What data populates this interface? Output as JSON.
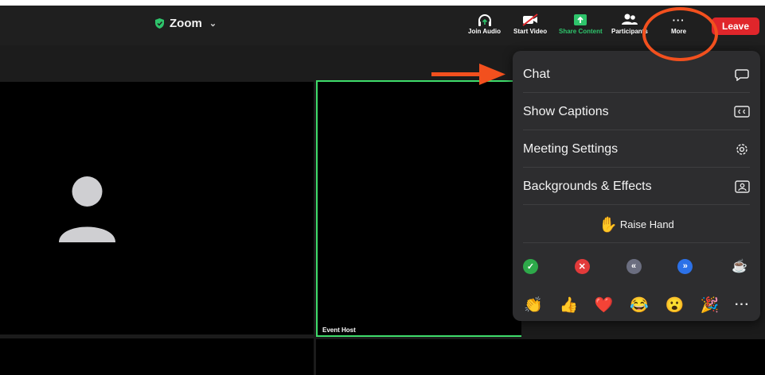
{
  "window": {
    "title": "Zoom",
    "title_chevron": "⌄"
  },
  "toolbar": {
    "join_audio": "Join Audio",
    "start_video": "Start Video",
    "share_content": "Share Content",
    "participants": "Participants",
    "more": "More",
    "more_dots": "···",
    "leave": "Leave"
  },
  "colors": {
    "accent_green": "#3fdc6b",
    "leave_red": "#e0262b",
    "annotation_orange": "#f2501e"
  },
  "tiles": {
    "host_label": "Event Host"
  },
  "menu": {
    "items": [
      {
        "label": "Chat",
        "icon": "chat-bubble-icon"
      },
      {
        "label": "Show Captions",
        "icon": "cc-icon"
      },
      {
        "label": "Meeting Settings",
        "icon": "gear-icon"
      },
      {
        "label": "Backgrounds & Effects",
        "icon": "portrait-icon"
      }
    ],
    "raise_hand": {
      "emoji": "✋",
      "label": "Raise Hand"
    },
    "feedback_row": [
      {
        "name": "yes-check",
        "glyph": "✓",
        "color": "#2ea94a"
      },
      {
        "name": "no-x",
        "glyph": "✕",
        "color": "#e23a3a"
      },
      {
        "name": "go-slower",
        "glyph": "«",
        "color": "#6b6e80"
      },
      {
        "name": "go-faster",
        "glyph": "»",
        "color": "#2c71e8"
      },
      {
        "name": "coffee-break",
        "glyph": "☕",
        "color": ""
      }
    ],
    "reactions": [
      "👏",
      "👍",
      "❤️",
      "😂",
      "😮",
      "🎉"
    ],
    "reactions_more": "···"
  }
}
